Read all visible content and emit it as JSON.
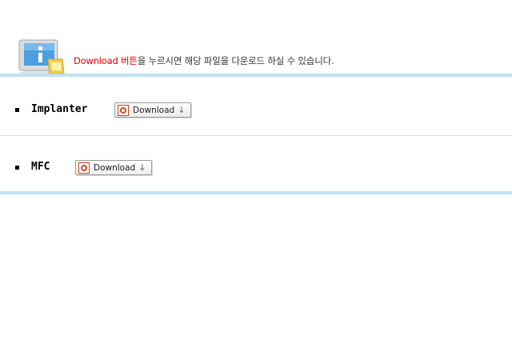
{
  "header": {
    "notice_accent": "Download 버튼",
    "notice_rest": "을 누르시면 해당 파일을 다운로드 하실 수 있습니다.",
    "icon": "monitor-info-icon"
  },
  "items": [
    {
      "label": "Implanter",
      "button_label": "Download",
      "button_arrow": "↓",
      "file_icon": "pdf-icon"
    },
    {
      "label": "MFC",
      "button_label": "Download",
      "button_arrow": "↓",
      "file_icon": "pdf-icon"
    }
  ],
  "colors": {
    "accent": "#e60000",
    "rule": "#bfe3f0",
    "text": "#333333"
  }
}
